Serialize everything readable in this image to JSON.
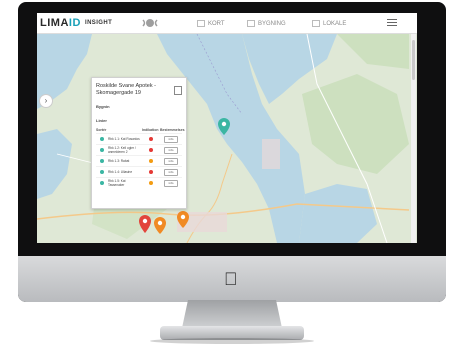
{
  "app": {
    "logo_prefix": "LIMA",
    "logo_accent": "ID",
    "insight": "INSIGHT"
  },
  "nav": {
    "items": [
      {
        "label": "KORT"
      },
      {
        "label": "BYGNING"
      },
      {
        "label": "LOKALE"
      }
    ]
  },
  "popup": {
    "title": "Roskilde Svane Apotek - Skomagergade 19",
    "section_building": "Bygnin",
    "section_lines": "Linier",
    "columns": [
      "Sortér",
      "",
      "Indikation",
      "Bestemmelses"
    ],
    "rows": [
      {
        "name": "Rbk 1.1: Kat Rosanlos",
        "status": "green",
        "ind": "#e53935",
        "btn": "info"
      },
      {
        "name": "Rbk 1.2: Kell ogler / anmelderen 2",
        "status": "teal",
        "ind": "#e53935",
        "btn": "info"
      },
      {
        "name": "Rbk 1.3: Rabat",
        "status": "teal",
        "ind": "#f39c12",
        "btn": "info"
      },
      {
        "name": "Rbk 1.4: Ullasine",
        "status": "teal",
        "ind": "#e53935",
        "btn": "info"
      },
      {
        "name": "Rbk 1.5: Kat Tassenaker",
        "status": "teal",
        "ind": "#f39c12",
        "btn": "info"
      }
    ]
  },
  "colors": {
    "water": "#b8d6e5",
    "land": "#dfe8d6",
    "accent": "#1aa0b8",
    "marker_teal": "#3bb6a3",
    "marker_red": "#e2453c",
    "marker_orange": "#f08a24"
  }
}
